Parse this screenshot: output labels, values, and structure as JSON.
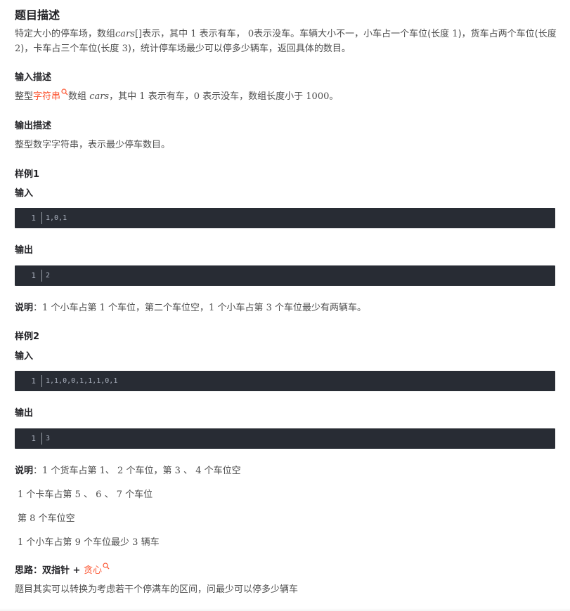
{
  "title": "题目描述",
  "description": {
    "t1": "特定大小的停车场，数组",
    "var1": "cars",
    "t2": "[]表示，其中",
    "n1": "1",
    "t3": "表示有车，",
    "n2": "0",
    "t4": "表示没车。车辆大小不一，小车占一个车位(长度",
    "n3": "1",
    "t5": ")，货车占两个车位(长度",
    "n4": "2",
    "t6": ")，卡车占三个车位(长度",
    "n5": "3",
    "t7": ")，统计停车场最少可以停多少辆车，返回具体的数目。"
  },
  "input_desc": {
    "heading": "输入描述",
    "pre": "整型",
    "link": "字符串",
    "t1": "数组",
    "var": "cars",
    "t2": "，其中",
    "n1": "1",
    "t3": "表示有车，",
    "n2": "0",
    "t4": "表示没车，数组长度小于",
    "n3": "1000",
    "t5": "。"
  },
  "output_desc": {
    "heading": "输出描述",
    "text": "整型数字字符串，表示最少停车数目。"
  },
  "example1": {
    "heading": "样例1",
    "input_label": "输入",
    "input_line_no": "1",
    "input_code": "1,0,1",
    "output_label": "输出",
    "output_line_no": "1",
    "output_code": "2",
    "note_label": "说明",
    "note": {
      "colon": "：",
      "n1": "1",
      "t1": "个小车占第",
      "n2": "1",
      "t2": "个车位，第二个车位空，",
      "n3": "1",
      "t3": "个小车占第",
      "n4": "3",
      "t4": "个车位最少有两辆车。"
    }
  },
  "example2": {
    "heading": "样例2",
    "input_label": "输入",
    "input_line_no": "1",
    "input_code": "1,1,0,0,1,1,1,0,1",
    "output_label": "输出",
    "output_line_no": "1",
    "output_code": "3",
    "note_label": "说明",
    "note": {
      "colon": "：",
      "l1_n1": "1",
      "l1_t1": "个货车占第",
      "l1_n2": "1",
      "l1_t2": "、",
      "l1_n3": "2",
      "l1_t3": "个车位，第",
      "l1_n4": "3",
      "l1_t4": "、",
      "l1_n5": "4",
      "l1_t5": "个车位空",
      "l2_n1": "1",
      "l2_t1": "个卡车占第",
      "l2_n2": "5",
      "l2_t2": "、",
      "l2_n3": "6",
      "l2_t3": "、",
      "l2_n4": "7",
      "l2_t4": "个车位",
      "l3_t1": "第",
      "l3_n1": "8",
      "l3_t2": "个车位空",
      "l4_n1": "1",
      "l4_t1": "个小车占第",
      "l4_n2": "9",
      "l4_t2": "个车位最少",
      "l4_n3": "3",
      "l4_t3": "辆车"
    }
  },
  "approach": {
    "label": "思路：双指针",
    "plus": "+",
    "link": "贪心",
    "text": "题目其实可以转换为考虑若干个停满车的区间，问最少可以停多少辆车"
  },
  "colors": {
    "accent_link": "#fc5531",
    "code_bg": "#282c34",
    "code_text": "#abb2bf"
  },
  "icons": [
    "search-icon"
  ]
}
